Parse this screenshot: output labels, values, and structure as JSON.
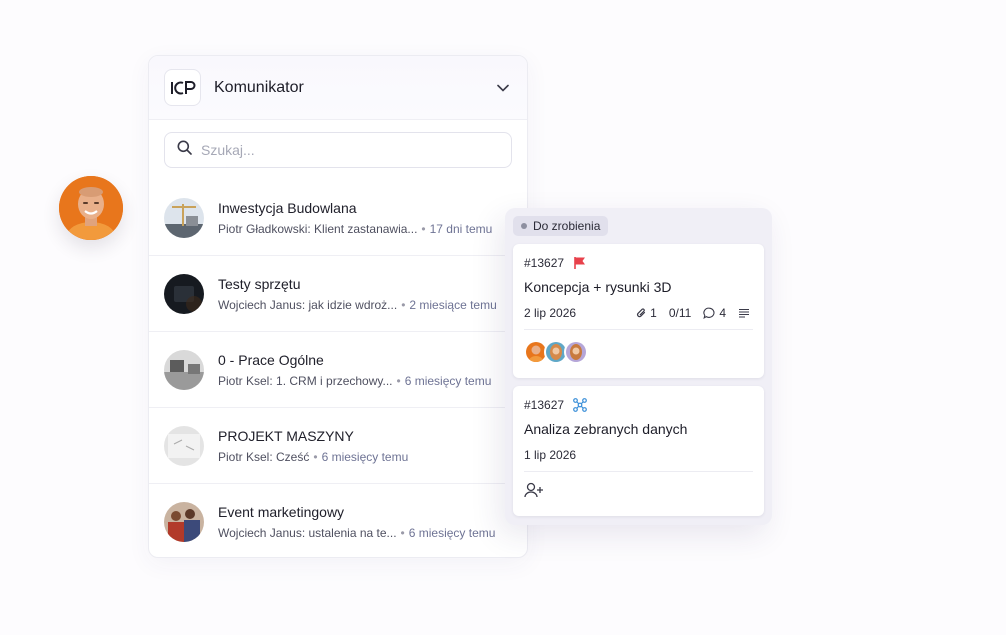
{
  "app": {
    "title": "Komunikator",
    "logo_text": "ICP"
  },
  "search": {
    "placeholder": "Szukaj..."
  },
  "conversations": [
    {
      "name": "Inwestycja Budowlana",
      "preview": "Piotr Gładkowski: Klient zastanawia...",
      "time": "17 dni temu"
    },
    {
      "name": "Testy sprzętu",
      "preview": "Wojciech Janus: jak idzie wdroż...",
      "time": "2 miesiące temu"
    },
    {
      "name": "0 - Prace Ogólne",
      "preview": "Piotr Ksel: 1. CRM i przechowy...",
      "time": "6 miesięcy temu"
    },
    {
      "name": "PROJEKT MASZYNY",
      "preview": "Piotr Ksel: Cześć",
      "time": "6 miesięcy temu"
    },
    {
      "name": "Event marketingowy",
      "preview": "Wojciech Janus: ustalenia na te...",
      "time": "6 miesięcy temu"
    }
  ],
  "kanban": {
    "column_label": "Do zrobienia",
    "cards": [
      {
        "id": "#13627",
        "title": "Koncepcja + rysunki 3D",
        "date": "2 lip 2026",
        "attachments": "1",
        "checklist": "0/11",
        "comments": "4",
        "icon": "red-flag-icon"
      },
      {
        "id": "#13627",
        "title": "Analiza zebranych danych",
        "date": "1 lip 2026",
        "icon": "network-icon"
      }
    ]
  },
  "colors": {
    "accent_flag": "#e8414b",
    "network": "#3a8fd8",
    "time_text": "#6e7394"
  }
}
